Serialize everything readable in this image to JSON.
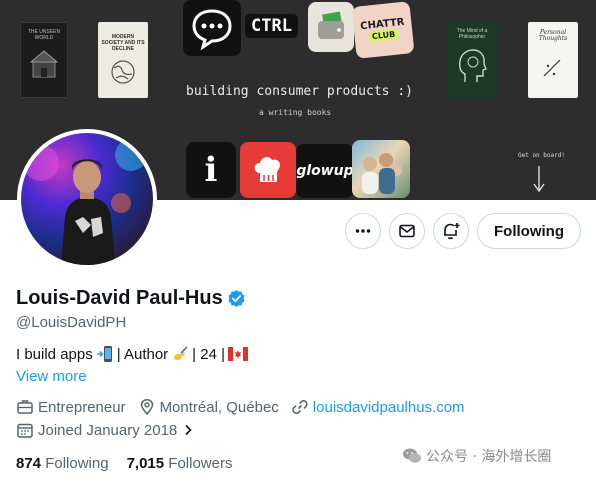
{
  "banner": {
    "headline": "building consumer products :)",
    "subheadline": "a writing books",
    "books": [
      {
        "title": "THE UNSEEN WORLD"
      },
      {
        "title": "MODERN SOCIETY AND ITS DECLINE"
      },
      {
        "title": "The Mind of a Philosopher"
      },
      {
        "title": "Personal Thoughts"
      }
    ],
    "apps": {
      "ctrl": "CTRL",
      "chatter": "CHATTR",
      "chatter_badge": "CLUB",
      "i_logo": "i",
      "glowup": "glowup"
    },
    "onboard_text": "Get on board!"
  },
  "actions": {
    "following_label": "Following"
  },
  "profile": {
    "display_name": "Louis-David Paul-Hus",
    "handle": "@LouisDavidPH",
    "bio_part1": "I build apps",
    "bio_part2": "| Author",
    "bio_part3": "| 24 |",
    "view_more": "View more",
    "profession": "Entrepreneur",
    "location": "Montréal, Québec",
    "website": "louisdavidpaulhus.com",
    "joined": "Joined January 2018"
  },
  "stats": {
    "following_count": "874",
    "following_label": "Following",
    "followers_count": "7,015",
    "followers_label": "Followers"
  },
  "watermark": {
    "text": "公众号 · 海外增长圈"
  },
  "colors": {
    "accent": "#1d9bf0",
    "verified": "#1d9bf0",
    "text_primary": "#0f1419",
    "text_secondary": "#536471",
    "banner_bg": "#2d2d2d"
  }
}
